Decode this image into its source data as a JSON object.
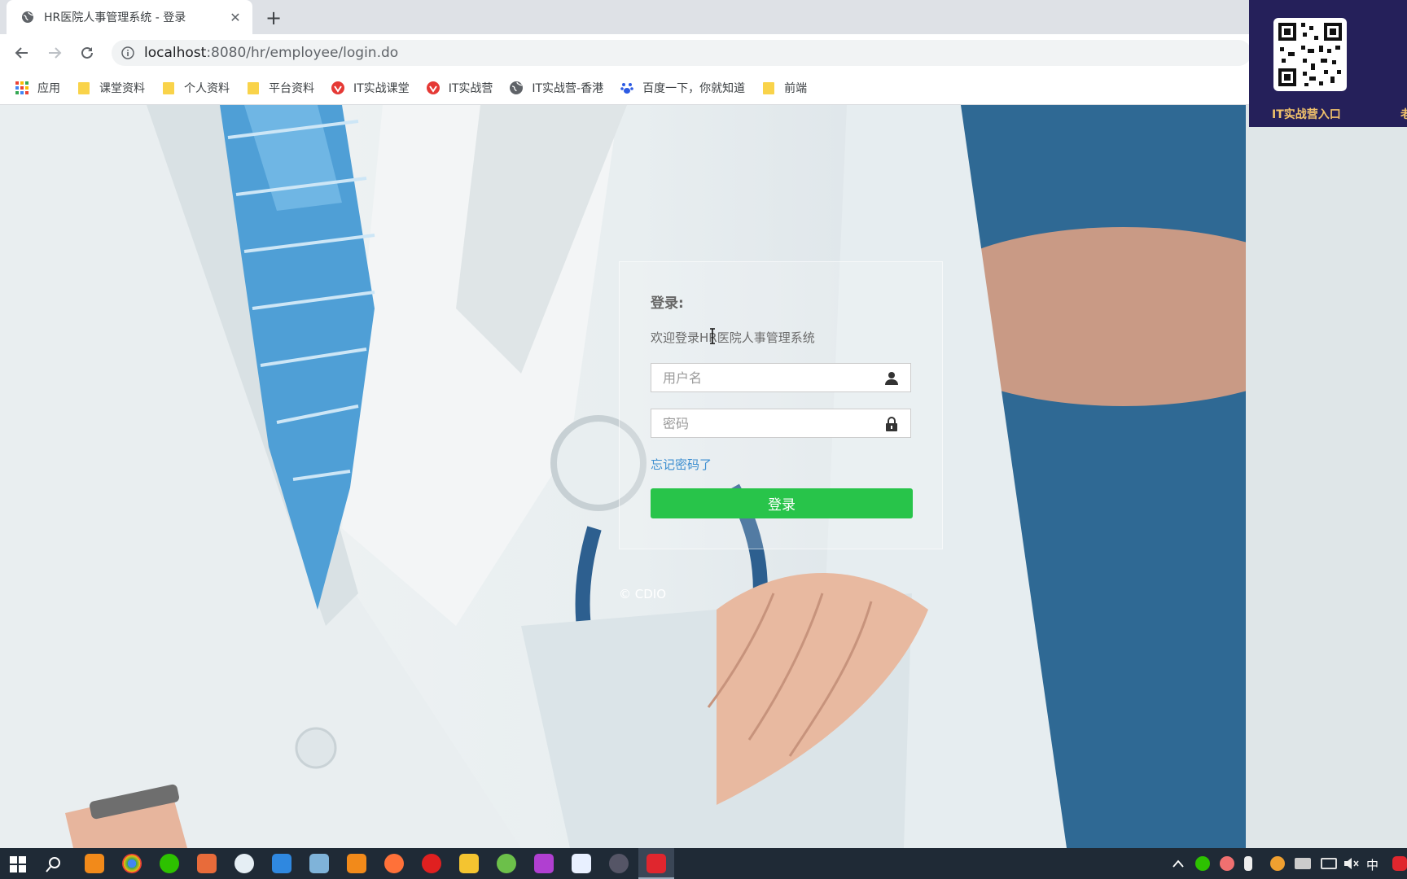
{
  "browser": {
    "tab_title": "HR医院人事管理系统 - 登录",
    "tab_close": "✕",
    "new_tab": "+",
    "url_host": "localhost",
    "url_path": ":8080/hr/employee/login.do",
    "bookmarks": [
      {
        "label": "应用",
        "icon": "apps-grid-icon"
      },
      {
        "label": "课堂资料",
        "icon": "folder-icon"
      },
      {
        "label": "个人资料",
        "icon": "folder-icon"
      },
      {
        "label": "平台资料",
        "icon": "folder-icon"
      },
      {
        "label": "IT实战课堂",
        "icon": "red-site-icon"
      },
      {
        "label": "IT实战营",
        "icon": "red-site-icon"
      },
      {
        "label": "IT实战营-香港",
        "icon": "globe-icon"
      },
      {
        "label": "百度一下，你就知道",
        "icon": "baidu-paw-icon"
      },
      {
        "label": "前端",
        "icon": "folder-icon"
      }
    ]
  },
  "login": {
    "title": "登录:",
    "subtitle": "欢迎登录HR医院人事管理系统",
    "username_placeholder": "用户名",
    "password_placeholder": "密码",
    "forgot_link": "忘记密码了",
    "submit_label": "登录",
    "copyright": "© CDIO"
  },
  "overlay": {
    "qr_label": "IT实战营入口",
    "qr_label_extra": "老"
  },
  "taskbar": {
    "tray_ime": "中"
  },
  "colors": {
    "login_button": "#28c44a",
    "link": "#3d8ed0",
    "overlay_bg": "#25205a",
    "overlay_text": "#f2c36b"
  }
}
